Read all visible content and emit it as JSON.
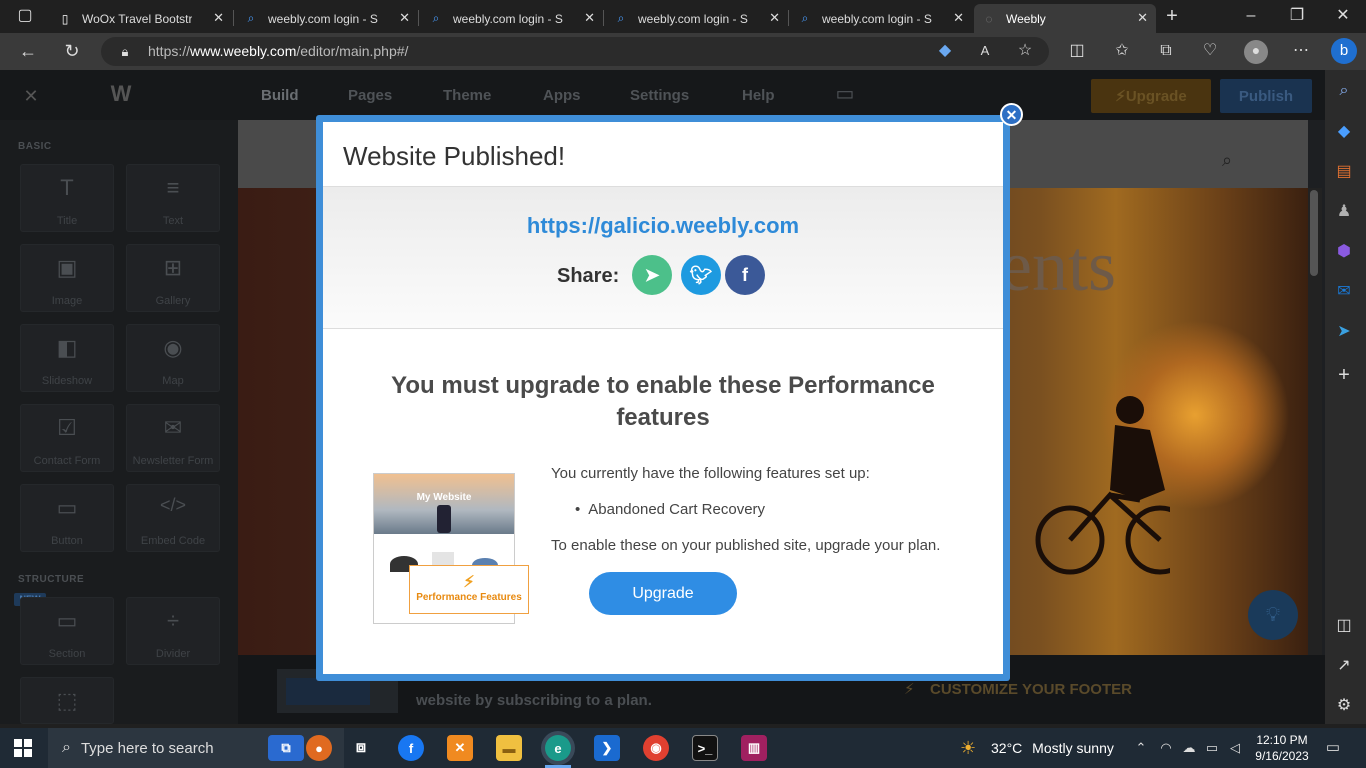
{
  "browser": {
    "tabs": [
      {
        "title": "WoOx Travel Bootstrap",
        "icon": "page-icon"
      },
      {
        "title": "weebly.com login - Sea",
        "icon": "search-icon"
      },
      {
        "title": "weebly.com login - Sea",
        "icon": "search-icon"
      },
      {
        "title": "weebly.com login - Sea",
        "icon": "search-icon"
      },
      {
        "title": "weebly.com login - Sea",
        "icon": "search-icon"
      },
      {
        "title": "Weebly",
        "icon": "weebly-icon",
        "active": true
      }
    ],
    "url_prefix": "https://",
    "url_domain": "www.weebly.com",
    "url_path": "/editor/main.php#/"
  },
  "editor": {
    "nav": [
      "Build",
      "Pages",
      "Theme",
      "Apps",
      "Settings",
      "Help"
    ],
    "upgrade_label": "Upgrade",
    "publish_label": "Publish",
    "sections": {
      "basic": "BASIC",
      "structure": "STRUCTURE",
      "new_badge": "NEW"
    },
    "tiles": [
      {
        "label": "Title",
        "icon": "T"
      },
      {
        "label": "Text",
        "icon": "≡"
      },
      {
        "label": "Image",
        "icon": "▣"
      },
      {
        "label": "Gallery",
        "icon": "⊞"
      },
      {
        "label": "Slideshow",
        "icon": "◧"
      },
      {
        "label": "Map",
        "icon": "◉"
      },
      {
        "label": "Contact Form",
        "icon": "☑"
      },
      {
        "label": "Newsletter Form",
        "icon": "✉"
      },
      {
        "label": "Button",
        "icon": "▭"
      },
      {
        "label": "Embed Code",
        "icon": "</>"
      },
      {
        "label": "Section",
        "icon": "▭"
      },
      {
        "label": "Divider",
        "icon": "÷"
      }
    ],
    "hero_text": "ents",
    "footer_text": "website by subscribing to a plan.",
    "customize_footer": "CUSTOMIZE YOUR FOOTER"
  },
  "modal": {
    "title": "Website Published!",
    "site_url": "https://galicio.weebly.com",
    "share_label": "Share:",
    "upgrade_heading": "You must upgrade to enable these Performance features",
    "features_intro": "You currently have the following features set up:",
    "features": [
      "Abandoned Cart Recovery"
    ],
    "enable_text": "To enable these on your published site, upgrade your plan.",
    "upgrade_button": "Upgrade",
    "thumb_title": "My Website",
    "thumb_badge": "Performance Features",
    "colors": {
      "accent": "#2f8de4",
      "frame": "#3f8ed8"
    }
  },
  "taskbar": {
    "search_placeholder": "Type here to search",
    "weather_temp": "32°C",
    "weather_desc": "Mostly sunny",
    "time": "12:10 PM",
    "date": "9/16/2023"
  }
}
